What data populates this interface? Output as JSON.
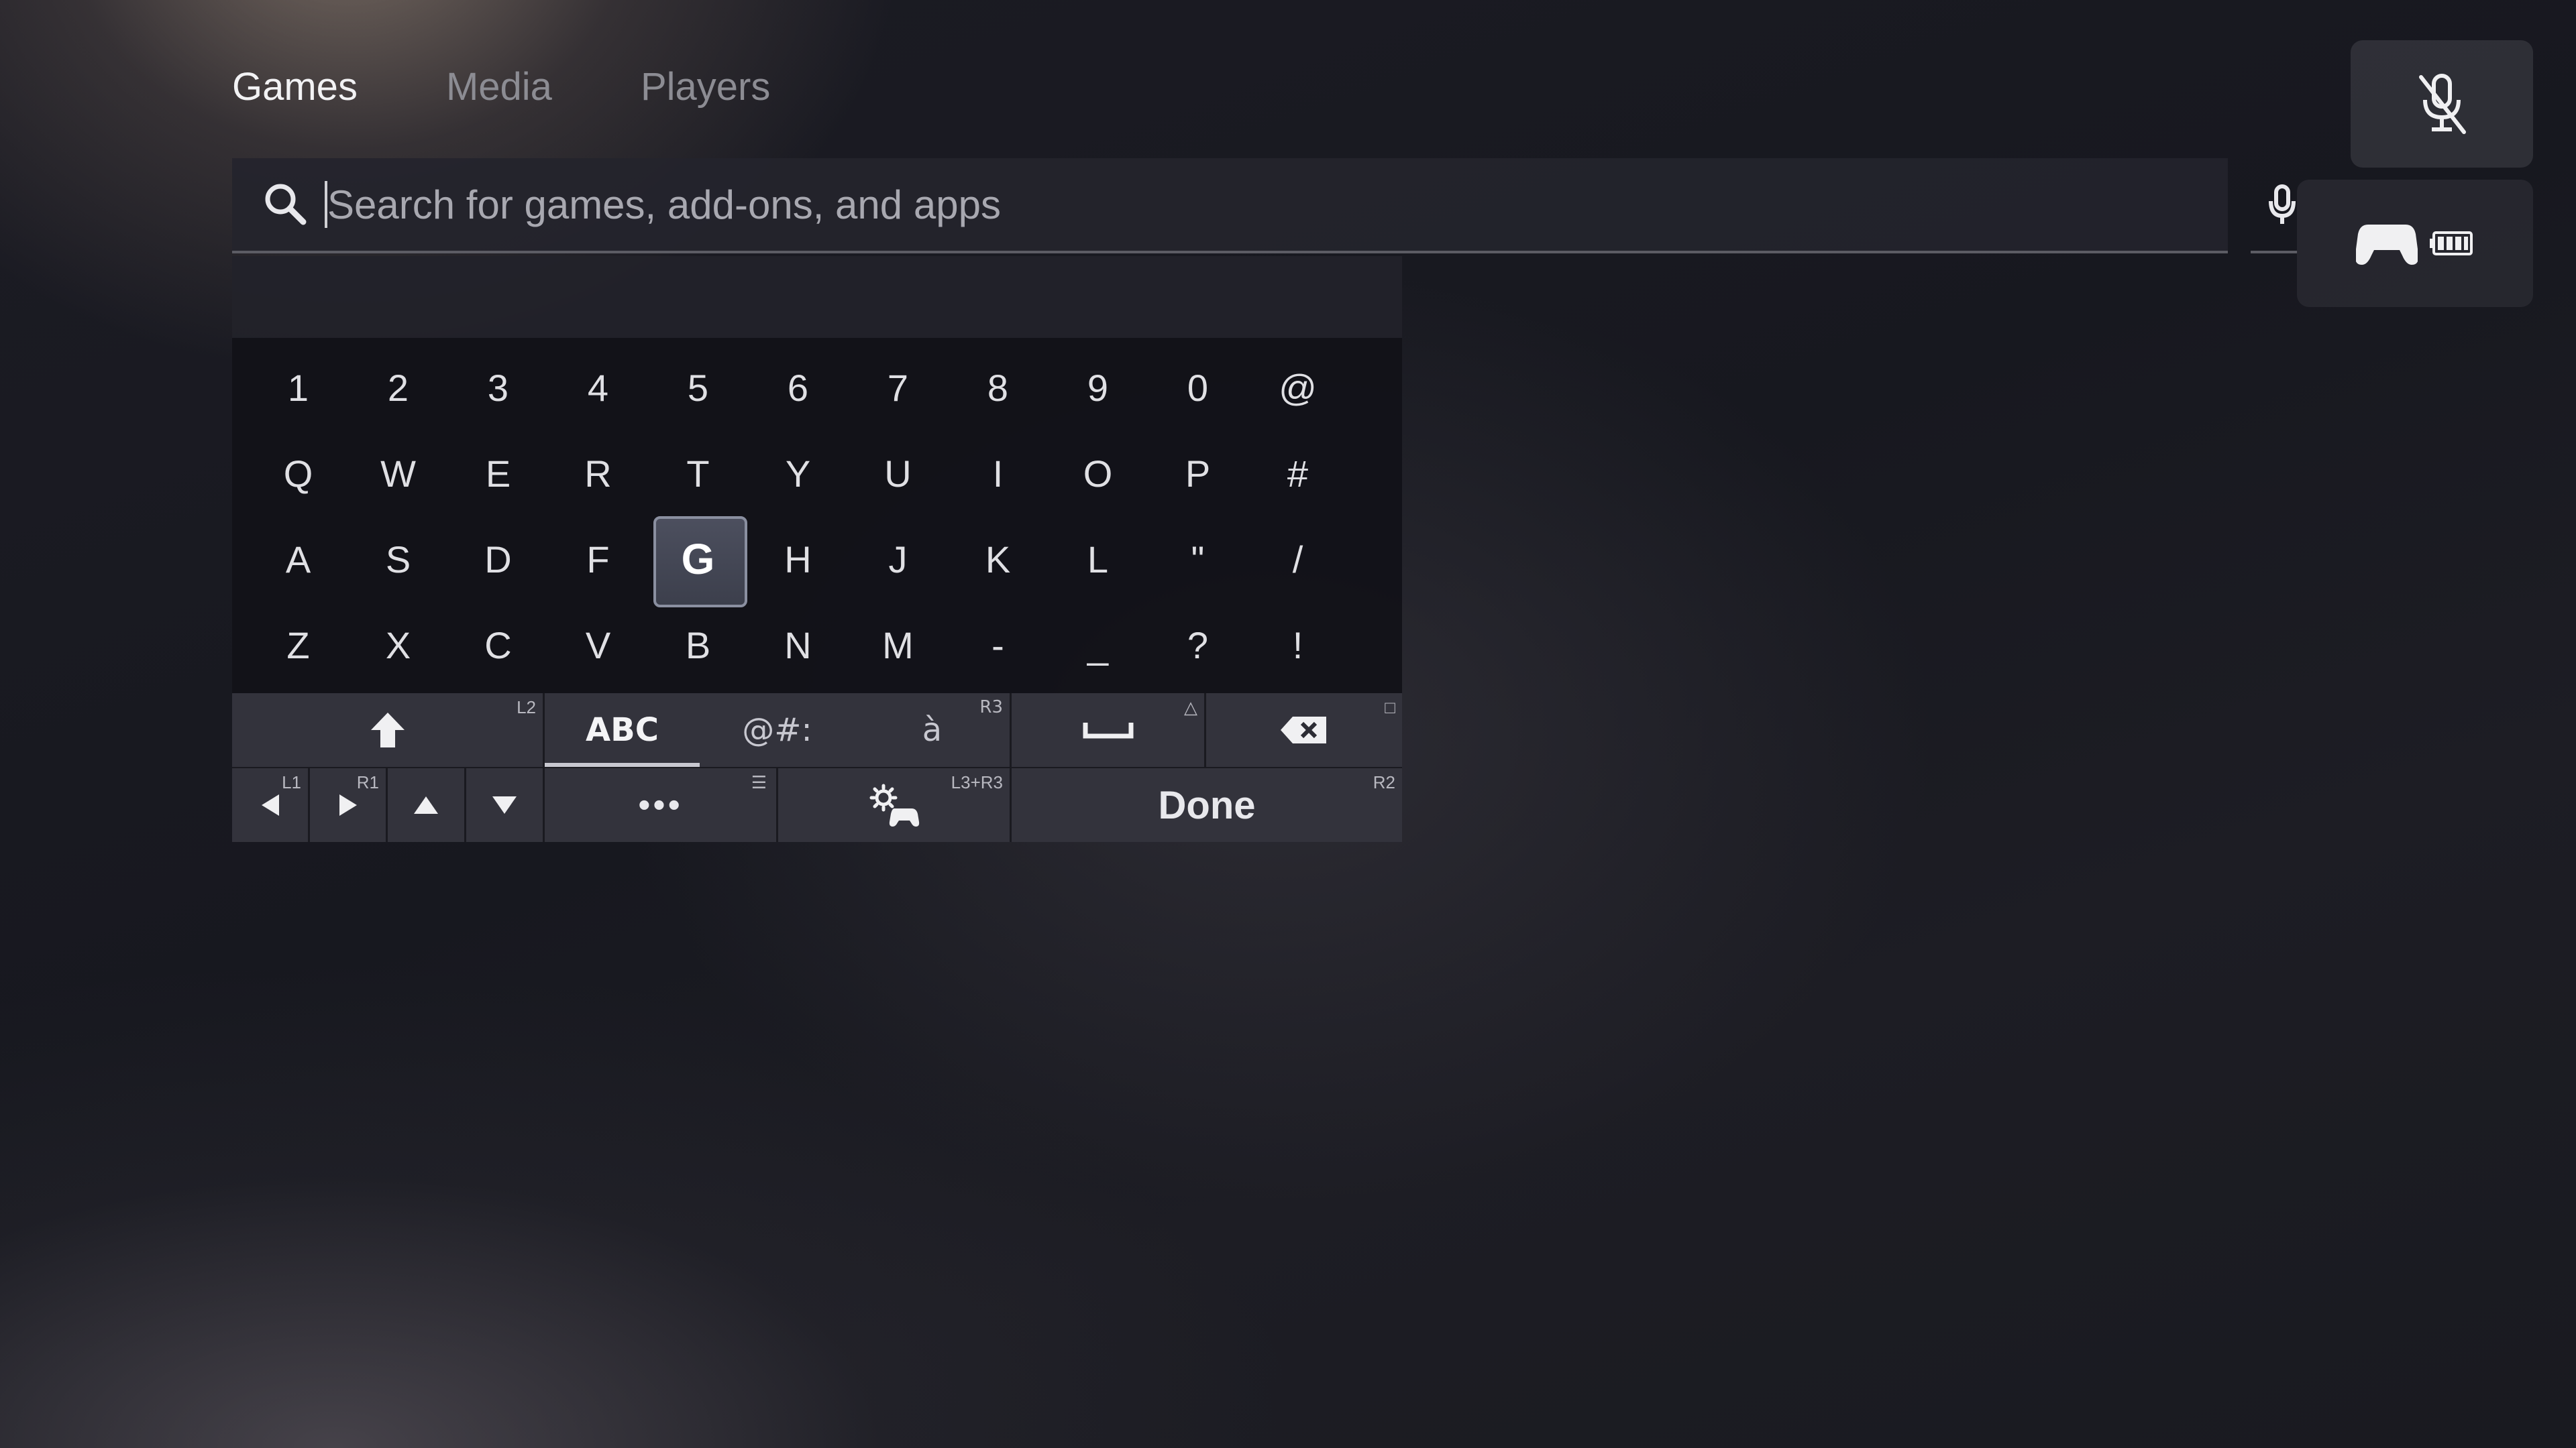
{
  "tabs": [
    {
      "label": "Games",
      "active": true
    },
    {
      "label": "Media",
      "active": false
    },
    {
      "label": "Players",
      "active": false
    }
  ],
  "search": {
    "placeholder": "Search for games, add-ons, and apps",
    "value": ""
  },
  "keyboard": {
    "rows": [
      [
        "1",
        "2",
        "3",
        "4",
        "5",
        "6",
        "7",
        "8",
        "9",
        "0",
        "@"
      ],
      [
        "Q",
        "W",
        "E",
        "R",
        "T",
        "Y",
        "U",
        "I",
        "O",
        "P",
        "#"
      ],
      [
        "A",
        "S",
        "D",
        "F",
        "G",
        "H",
        "J",
        "K",
        "L",
        "\"",
        "/"
      ],
      [
        "Z",
        "X",
        "C",
        "V",
        "B",
        "N",
        "M",
        "-",
        "_",
        "?",
        "!"
      ]
    ],
    "focused_key": "G",
    "modes": [
      {
        "label": "ABC",
        "active": true
      },
      {
        "label": "@#:",
        "active": false
      },
      {
        "label": "à",
        "active": false
      }
    ],
    "hints": {
      "shift": "L2",
      "accent": "R3",
      "space": "△",
      "backspace": "□",
      "left": "L1",
      "right": "R1",
      "options": "☰",
      "controller": "L3+R3",
      "done": "R2"
    },
    "more_label": "•••",
    "done_label": "Done"
  },
  "colors": {
    "background": "#1c1c24",
    "focus_key": "#4c4f5e",
    "widget": "#32323a"
  },
  "icons": {
    "search": "search-icon",
    "mic": "mic-icon",
    "mic_muted": "mic-muted-icon",
    "controller": "controller-icon",
    "battery": "battery-icon"
  }
}
